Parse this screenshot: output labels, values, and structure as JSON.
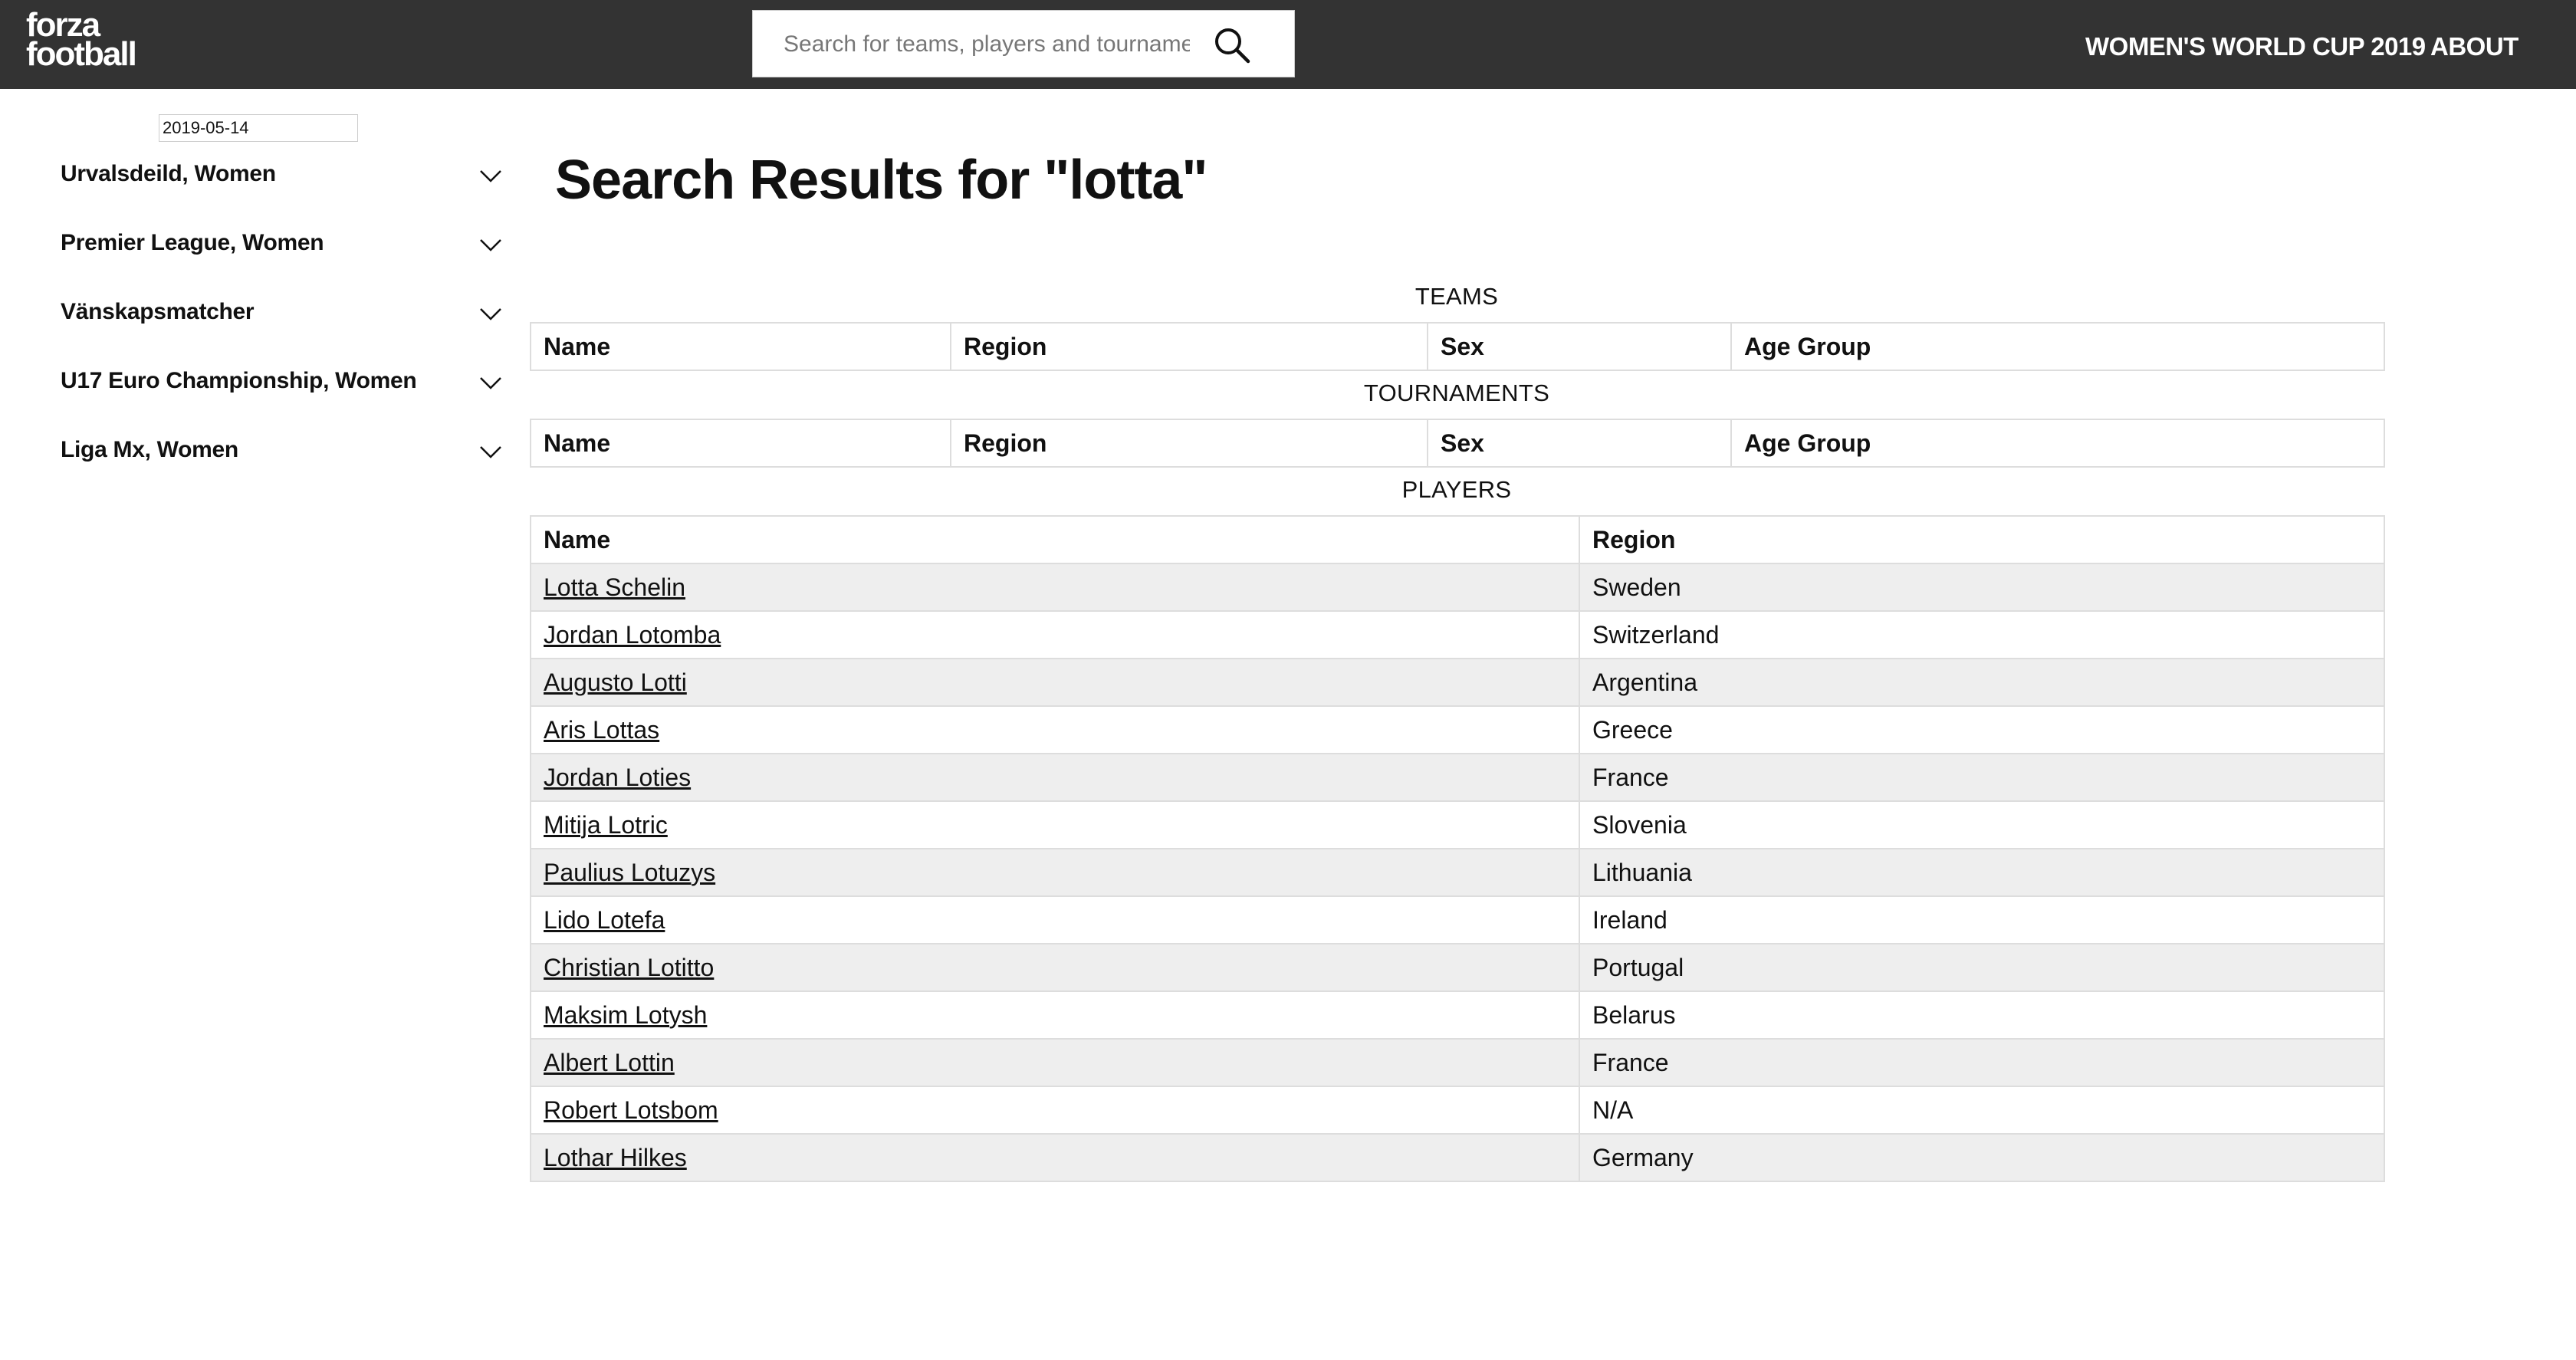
{
  "header": {
    "logo_line1": "forza",
    "logo_line2": "football",
    "search_placeholder": "Search for teams, players and tournaments",
    "nav": [
      "WOMEN'S WORLD CUP 2019",
      "ABOUT"
    ]
  },
  "sidebar": {
    "date": "2019-05-14",
    "leagues": [
      "Urvalsdeild, Women",
      "Premier League, Women",
      "Vänskapsmatcher",
      "U17 Euro Championship, Women",
      "Liga Mx, Women"
    ]
  },
  "main": {
    "title": "Search Results for \"lotta\"",
    "teams": {
      "caption": "TEAMS",
      "columns": [
        "Name",
        "Region",
        "Sex",
        "Age Group"
      ]
    },
    "tournaments": {
      "caption": "TOURNAMENTS",
      "columns": [
        "Name",
        "Region",
        "Sex",
        "Age Group"
      ]
    },
    "players": {
      "caption": "PLAYERS",
      "columns": [
        "Name",
        "Region"
      ],
      "rows": [
        {
          "name": "Lotta Schelin",
          "region": "Sweden"
        },
        {
          "name": "Jordan Lotomba",
          "region": "Switzerland"
        },
        {
          "name": "Augusto Lotti",
          "region": "Argentina"
        },
        {
          "name": "Aris Lottas",
          "region": "Greece"
        },
        {
          "name": "Jordan Loties",
          "region": "France"
        },
        {
          "name": "Mitija Lotric",
          "region": "Slovenia"
        },
        {
          "name": "Paulius Lotuzys",
          "region": "Lithuania"
        },
        {
          "name": "Lido Lotefa",
          "region": "Ireland"
        },
        {
          "name": "Christian Lotitto",
          "region": "Portugal"
        },
        {
          "name": "Maksim Lotysh",
          "region": "Belarus"
        },
        {
          "name": "Albert Lottin",
          "region": "France"
        },
        {
          "name": "Robert Lotsbom",
          "region": "N/A"
        },
        {
          "name": "Lothar Hilkes",
          "region": "Germany"
        }
      ]
    }
  },
  "colors": {
    "header_bg": "#333333",
    "row_alt_bg": "#eeeeee",
    "border": "#dddddd"
  },
  "icons": [
    "search-icon",
    "chevron-down-icon"
  ]
}
